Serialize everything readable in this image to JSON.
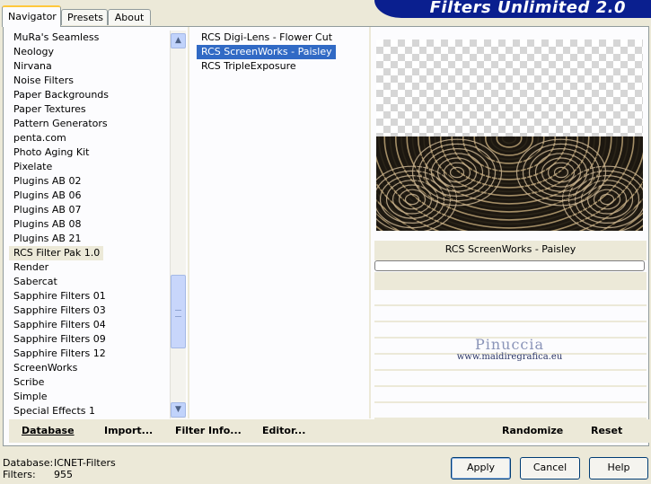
{
  "tabs": [
    {
      "label": "Navigator",
      "active": true
    },
    {
      "label": "Presets",
      "active": false
    },
    {
      "label": "About",
      "active": false
    }
  ],
  "banner": {
    "title": "Filters Unlimited 2.0",
    "color": "#0a1f8f"
  },
  "categories": {
    "items": [
      "MuRa's Seamless",
      "Neology",
      "Nirvana",
      "Noise Filters",
      "Paper Backgrounds",
      "Paper Textures",
      "Pattern Generators",
      "penta.com",
      "Photo Aging Kit",
      "Pixelate",
      "Plugins AB 02",
      "Plugins AB 06",
      "Plugins AB 07",
      "Plugins AB 08",
      "Plugins AB 21",
      "RCS Filter Pak 1.0",
      "Render",
      "Sabercat",
      "Sapphire Filters 01",
      "Sapphire Filters 03",
      "Sapphire Filters 04",
      "Sapphire Filters 09",
      "Sapphire Filters 12",
      "ScreenWorks",
      "Scribe",
      "Simple",
      "Special Effects 1"
    ],
    "selected": "RCS Filter Pak 1.0"
  },
  "filters": {
    "items": [
      "RCS Digi-Lens - Flower Cut",
      "RCS ScreenWorks - Paisley",
      "RCS TripleExposure"
    ],
    "selected": "RCS ScreenWorks - Paisley"
  },
  "preview": {
    "filter_name": "RCS ScreenWorks - Paisley"
  },
  "watermark": {
    "name": "Pinuccia",
    "url": "www.maidiregrafica.eu"
  },
  "links": {
    "database": "Database",
    "import": "Import...",
    "filter_info": "Filter Info...",
    "editor": "Editor...",
    "randomize": "Randomize",
    "reset": "Reset"
  },
  "status": {
    "database_label": "Database:",
    "database_value": "ICNET-Filters",
    "filters_label": "Filters:",
    "filters_value": "955"
  },
  "buttons": {
    "apply": "Apply",
    "cancel": "Cancel",
    "help": "Help"
  },
  "colors": {
    "selection": "#316ac5",
    "window": "#ece9d8"
  }
}
